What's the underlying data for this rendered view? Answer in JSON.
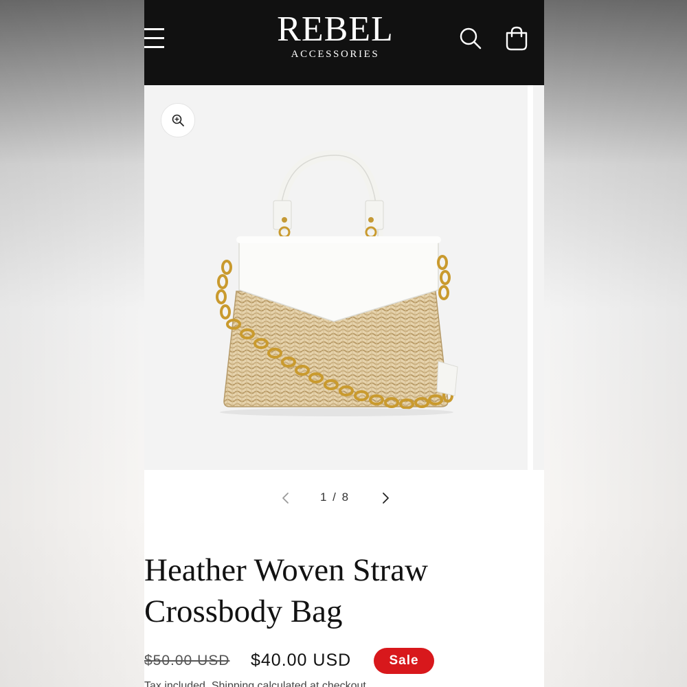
{
  "header": {
    "logo_main": "REBEL",
    "logo_sub": "ACCESSORIES",
    "menu_icon": "hamburger-menu-icon",
    "search_icon": "search-icon",
    "cart_icon": "shopping-bag-icon",
    "background_color": "#111111"
  },
  "gallery": {
    "zoom_icon": "zoom-in-icon",
    "image_description_icon": "woven-straw-crossbody-bag-image"
  },
  "slider": {
    "prev_icon": "chevron-left-icon",
    "next_icon": "chevron-right-icon",
    "counter": "1 / 8",
    "current": 1,
    "total": 8
  },
  "product": {
    "title_line1": "Heather Woven Straw",
    "title_line2": "Crossbody Bag",
    "compare_at_price": "$50.00 USD",
    "price": "$40.00 USD",
    "badge": "Sale",
    "badge_color": "#d8181c",
    "tax_note": "Tax included. Shipping calculated at checkout."
  }
}
